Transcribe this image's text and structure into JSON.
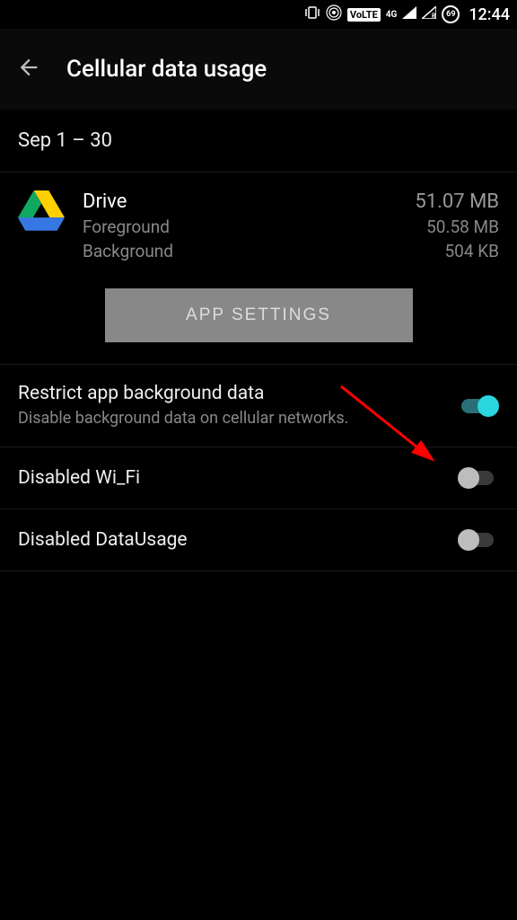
{
  "status_bar": {
    "volte_label": "VoLTE",
    "network_label": "4G",
    "battery_pct": "69",
    "clock": "12:44"
  },
  "header": {
    "title": "Cellular data usage"
  },
  "date_range": "Sep 1 – 30",
  "app": {
    "name": "Drive",
    "total": "51.07 MB",
    "foreground_label": "Foreground",
    "foreground_value": "50.58 MB",
    "background_label": "Background",
    "background_value": "504 KB"
  },
  "app_settings_button": "APP SETTINGS",
  "settings": {
    "restrict": {
      "title": "Restrict app background data",
      "subtitle": "Disable background data on cellular networks.",
      "enabled": true
    },
    "wifi": {
      "title": "Disabled Wi_Fi",
      "enabled": false
    },
    "data": {
      "title": "Disabled DataUsage",
      "enabled": false
    }
  }
}
